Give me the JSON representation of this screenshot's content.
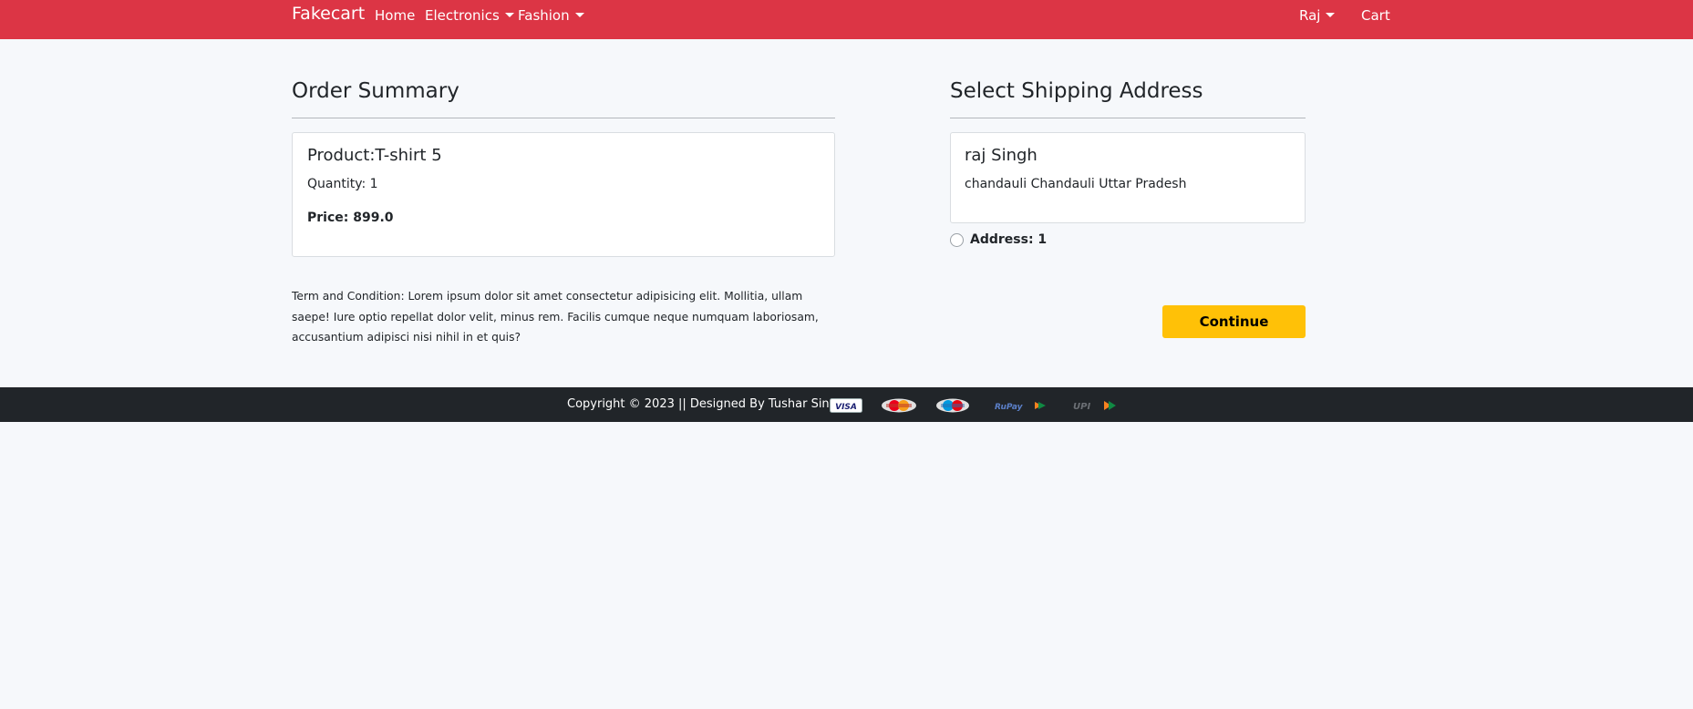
{
  "navbar": {
    "brand": "Fakecart",
    "links": {
      "home": "Home",
      "electronics": "Electronics",
      "fashion": "Fashion"
    },
    "user": "Raj",
    "cart": "Cart",
    "bg_color": "#dc3545"
  },
  "order_summary": {
    "heading": "Order Summary",
    "product_title": "Product:T-shirt 5",
    "quantity": "Quantity: 1",
    "price": "Price: 899.0",
    "terms": "Term and Condition: Lorem ipsum dolor sit amet consectetur adipisicing elit. Mollitia, ullam saepe! Iure optio repellat dolor velit, minus rem. Facilis cumque neque numquam laboriosam, accusantium adipisci nisi nihil in et quis?"
  },
  "shipping": {
    "heading": "Select Shipping Address",
    "name": "raj Singh",
    "address": "chandauli Chandauli Uttar Pradesh",
    "radio_label": "Address: 1",
    "radio_selected": false,
    "continue_label": "Continue",
    "button_color": "#ffc107"
  },
  "footer": {
    "copyright": "Copyright © 2023 || Designed By Tushar Singh ||",
    "payment_icons": [
      "visa-icon",
      "mastercard-icon",
      "maestro-icon",
      "rupay-icon",
      "upi-icon"
    ],
    "bg_color": "#212529"
  }
}
